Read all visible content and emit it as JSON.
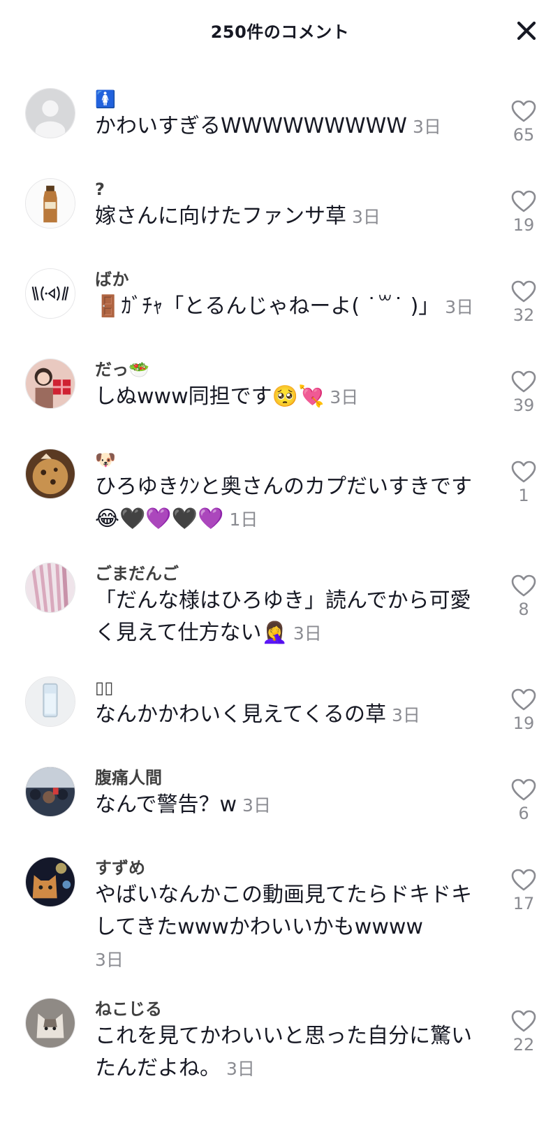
{
  "header": {
    "title": "250件のコメント"
  },
  "comments": [
    {
      "username": "🚺",
      "text": "かわいすぎるWWWWWWWWW",
      "time": "3日",
      "likes": "65",
      "avatar": "default-avatar"
    },
    {
      "username": "?",
      "text": "嫁さんに向けたファンサ草",
      "time": "3日",
      "likes": "19",
      "avatar": "tea-bottle"
    },
    {
      "username": "ばか",
      "text": "🚪ｶﾞﾁｬ「とるんじゃねーよ( ˙꒳˙ )」",
      "time": "3日",
      "likes": "32",
      "avatar": "kaomoji"
    },
    {
      "username": "だっ🥗",
      "text": "しぬwww同担です🥺💘",
      "time": "3日",
      "likes": "39",
      "avatar": "girl-gift"
    },
    {
      "username": "🐶",
      "text": "ひろゆきｸﾝと奥さんのカプだいすきです😂🖤💜🖤💜",
      "time": "1日",
      "likes": "1",
      "avatar": "cookie"
    },
    {
      "username": "ごまだんご",
      "text": "「だんな様はひろゆき」読んでから可愛く見えて仕方ない🤦‍♀️",
      "time": "3日",
      "likes": "8",
      "avatar": "pink-curtain"
    },
    {
      "username": "▯▯",
      "text": "なんかかわいく見えてくるの草",
      "time": "3日",
      "likes": "19",
      "avatar": "glass"
    },
    {
      "username": "腹痛人間",
      "text": "なんで警告？w",
      "time": "3日",
      "likes": "6",
      "avatar": "crowd"
    },
    {
      "username": "すずめ",
      "text": "やばいなんかこの動画見てたらドキドキしてきたwwwかわいいかもwwww",
      "time": "3日",
      "likes": "17",
      "avatar": "cat-bokeh"
    },
    {
      "username": "ねこじる",
      "text": "これを見てかわいいと思った自分に驚いたんだよね。",
      "time": "3日",
      "likes": "22",
      "avatar": "cat-grey"
    }
  ],
  "colors": {
    "text": "#161823",
    "username": "#404040",
    "meta": "#8a8b91"
  },
  "icons": {
    "close": "close-icon",
    "like": "heart-outline-icon"
  }
}
